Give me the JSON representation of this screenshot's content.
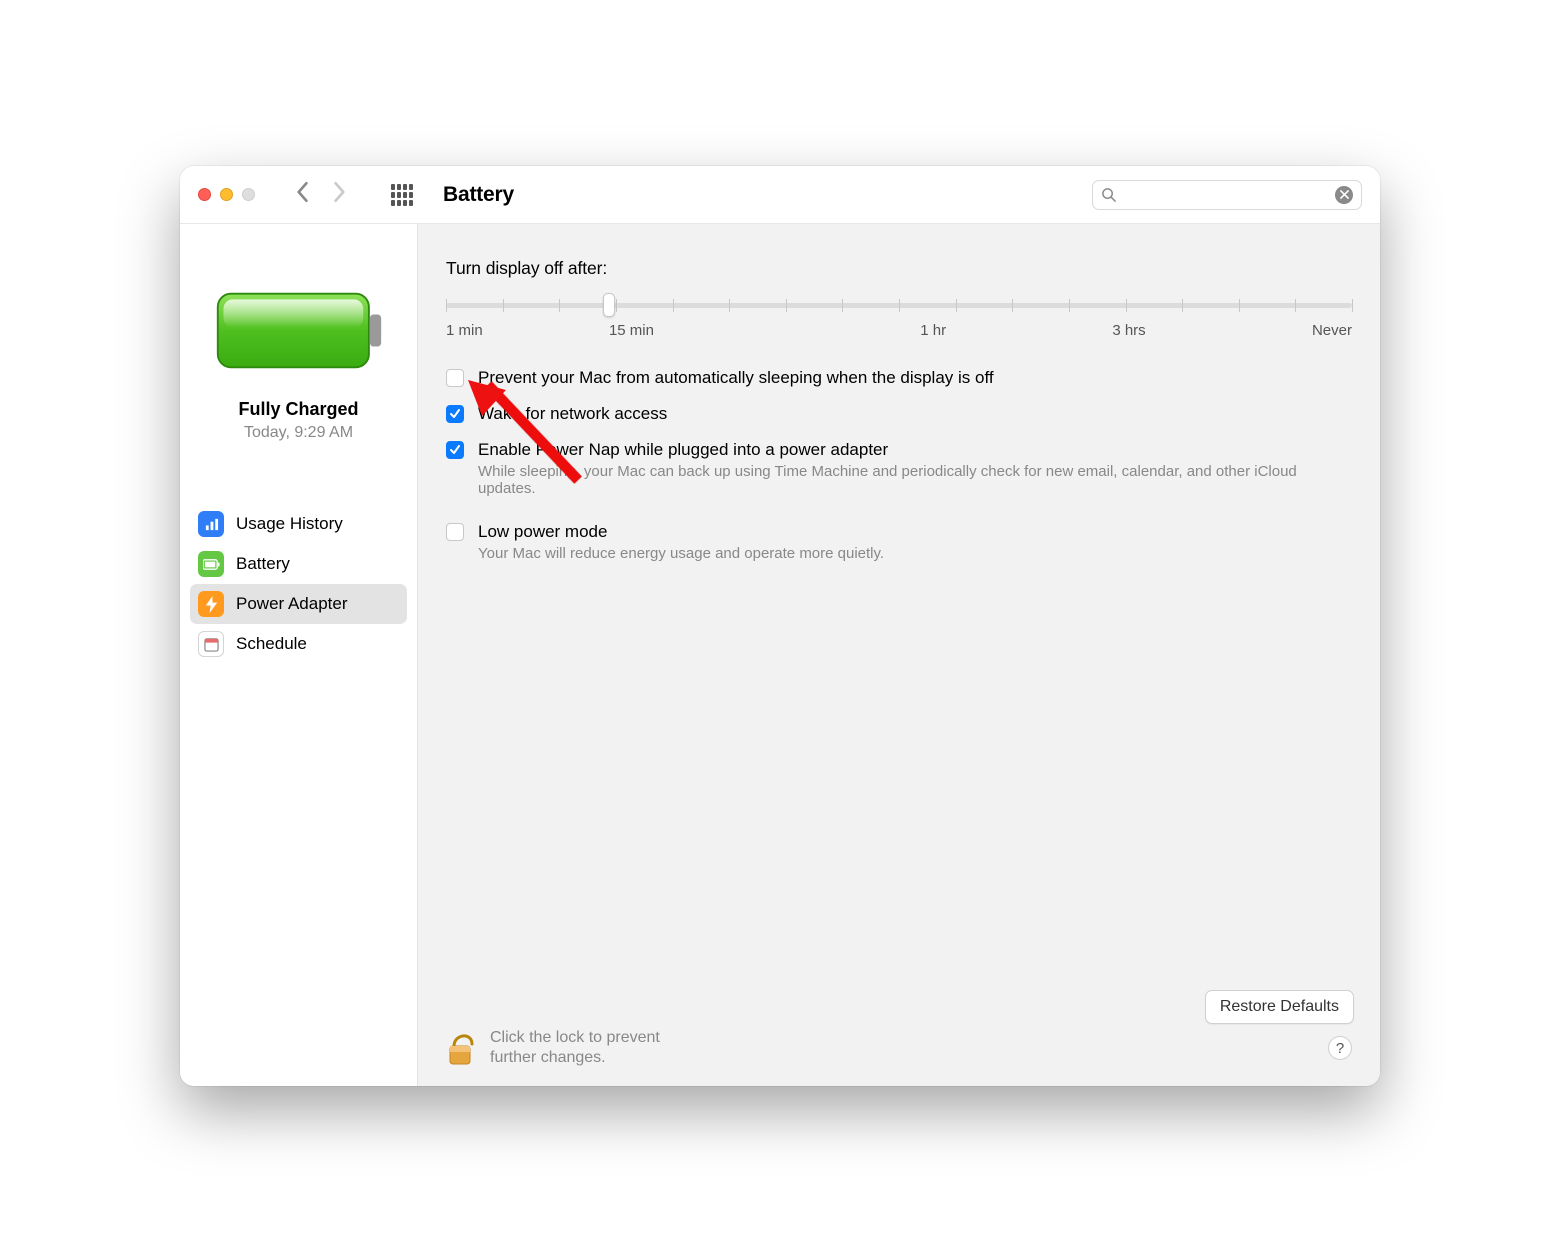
{
  "header": {
    "title": "Battery",
    "search_placeholder": ""
  },
  "sidebar": {
    "status_title": "Fully Charged",
    "status_sub": "Today, 9:29 AM",
    "items": [
      {
        "label": "Usage History"
      },
      {
        "label": "Battery"
      },
      {
        "label": "Power Adapter"
      },
      {
        "label": "Schedule"
      }
    ],
    "selected_index": 2
  },
  "main": {
    "slider_label": "Turn display off after:",
    "slider_labels": [
      "1 min",
      "15 min",
      "1 hr",
      "3 hrs",
      "Never"
    ],
    "slider_value_pct": 18,
    "options": [
      {
        "label": "Prevent your Mac from automatically sleeping when the display is off",
        "checked": false,
        "desc": ""
      },
      {
        "label": "Wake for network access",
        "checked": true,
        "desc": ""
      },
      {
        "label": "Enable Power Nap while plugged into a power adapter",
        "checked": true,
        "desc": "While sleeping, your Mac can back up using Time Machine and periodically check for new email, calendar, and other iCloud updates."
      },
      {
        "label": "Low power mode",
        "checked": false,
        "desc": "Your Mac will reduce energy usage and operate more quietly."
      }
    ],
    "restore_label": "Restore Defaults",
    "lock_text": "Click the lock to prevent further changes.",
    "help_label": "?"
  }
}
